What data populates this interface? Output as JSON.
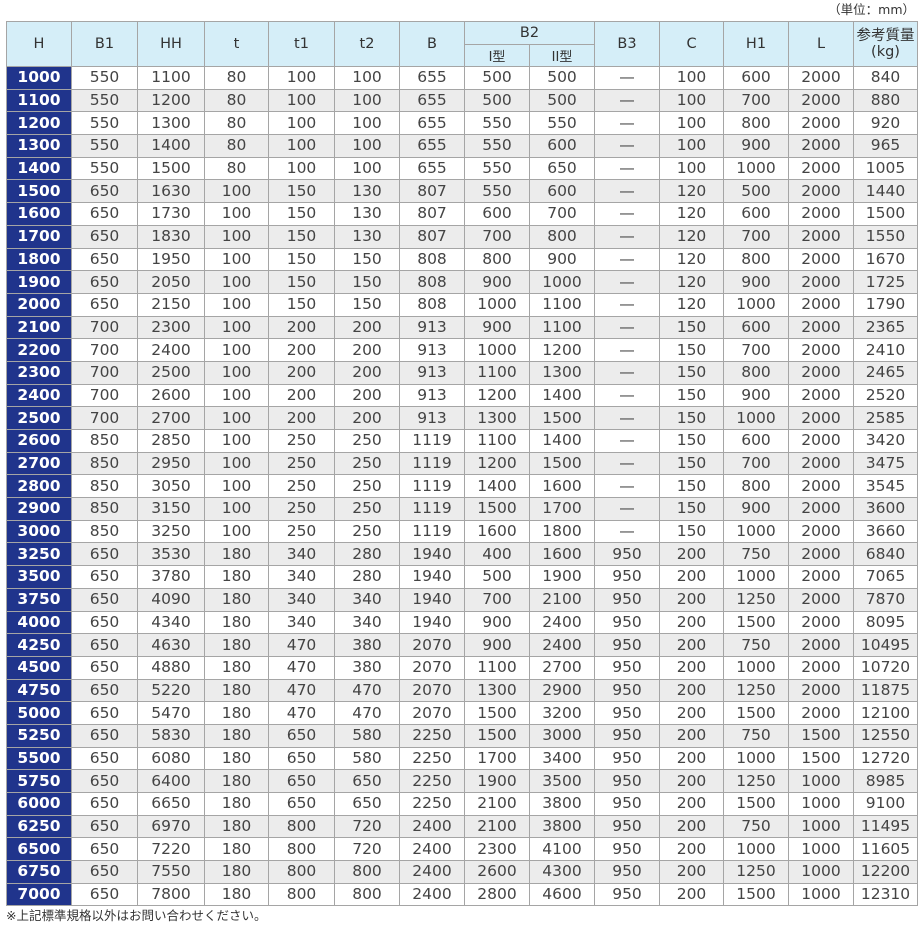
{
  "unit_label": "（単位：mm）",
  "headers": {
    "H": "H",
    "B1": "B1",
    "HH": "HH",
    "t": "t",
    "t1": "t1",
    "t2": "t2",
    "B": "B",
    "B2": "B2",
    "B2_type1": "I型",
    "B2_type2": "II型",
    "B3": "B3",
    "C": "C",
    "H1": "H1",
    "L": "L",
    "weight_line1": "参考質量",
    "weight_line2": "(kg)"
  },
  "rows": [
    [
      "1000",
      "550",
      "1100",
      "80",
      "100",
      "100",
      "655",
      "500",
      "500",
      "—",
      "100",
      "600",
      "2000",
      "840"
    ],
    [
      "1100",
      "550",
      "1200",
      "80",
      "100",
      "100",
      "655",
      "500",
      "500",
      "—",
      "100",
      "700",
      "2000",
      "880"
    ],
    [
      "1200",
      "550",
      "1300",
      "80",
      "100",
      "100",
      "655",
      "550",
      "550",
      "—",
      "100",
      "800",
      "2000",
      "920"
    ],
    [
      "1300",
      "550",
      "1400",
      "80",
      "100",
      "100",
      "655",
      "550",
      "600",
      "—",
      "100",
      "900",
      "2000",
      "965"
    ],
    [
      "1400",
      "550",
      "1500",
      "80",
      "100",
      "100",
      "655",
      "550",
      "650",
      "—",
      "100",
      "1000",
      "2000",
      "1005"
    ],
    [
      "1500",
      "650",
      "1630",
      "100",
      "150",
      "130",
      "807",
      "550",
      "600",
      "—",
      "120",
      "500",
      "2000",
      "1440"
    ],
    [
      "1600",
      "650",
      "1730",
      "100",
      "150",
      "130",
      "807",
      "600",
      "700",
      "—",
      "120",
      "600",
      "2000",
      "1500"
    ],
    [
      "1700",
      "650",
      "1830",
      "100",
      "150",
      "130",
      "807",
      "700",
      "800",
      "—",
      "120",
      "700",
      "2000",
      "1550"
    ],
    [
      "1800",
      "650",
      "1950",
      "100",
      "150",
      "150",
      "808",
      "800",
      "900",
      "—",
      "120",
      "800",
      "2000",
      "1670"
    ],
    [
      "1900",
      "650",
      "2050",
      "100",
      "150",
      "150",
      "808",
      "900",
      "1000",
      "—",
      "120",
      "900",
      "2000",
      "1725"
    ],
    [
      "2000",
      "650",
      "2150",
      "100",
      "150",
      "150",
      "808",
      "1000",
      "1100",
      "—",
      "120",
      "1000",
      "2000",
      "1790"
    ],
    [
      "2100",
      "700",
      "2300",
      "100",
      "200",
      "200",
      "913",
      "900",
      "1100",
      "—",
      "150",
      "600",
      "2000",
      "2365"
    ],
    [
      "2200",
      "700",
      "2400",
      "100",
      "200",
      "200",
      "913",
      "1000",
      "1200",
      "—",
      "150",
      "700",
      "2000",
      "2410"
    ],
    [
      "2300",
      "700",
      "2500",
      "100",
      "200",
      "200",
      "913",
      "1100",
      "1300",
      "—",
      "150",
      "800",
      "2000",
      "2465"
    ],
    [
      "2400",
      "700",
      "2600",
      "100",
      "200",
      "200",
      "913",
      "1200",
      "1400",
      "—",
      "150",
      "900",
      "2000",
      "2520"
    ],
    [
      "2500",
      "700",
      "2700",
      "100",
      "200",
      "200",
      "913",
      "1300",
      "1500",
      "—",
      "150",
      "1000",
      "2000",
      "2585"
    ],
    [
      "2600",
      "850",
      "2850",
      "100",
      "250",
      "250",
      "1119",
      "1100",
      "1400",
      "—",
      "150",
      "600",
      "2000",
      "3420"
    ],
    [
      "2700",
      "850",
      "2950",
      "100",
      "250",
      "250",
      "1119",
      "1200",
      "1500",
      "—",
      "150",
      "700",
      "2000",
      "3475"
    ],
    [
      "2800",
      "850",
      "3050",
      "100",
      "250",
      "250",
      "1119",
      "1400",
      "1600",
      "—",
      "150",
      "800",
      "2000",
      "3545"
    ],
    [
      "2900",
      "850",
      "3150",
      "100",
      "250",
      "250",
      "1119",
      "1500",
      "1700",
      "—",
      "150",
      "900",
      "2000",
      "3600"
    ],
    [
      "3000",
      "850",
      "3250",
      "100",
      "250",
      "250",
      "1119",
      "1600",
      "1800",
      "—",
      "150",
      "1000",
      "2000",
      "3660"
    ],
    [
      "3250",
      "650",
      "3530",
      "180",
      "340",
      "280",
      "1940",
      "400",
      "1600",
      "950",
      "200",
      "750",
      "2000",
      "6840"
    ],
    [
      "3500",
      "650",
      "3780",
      "180",
      "340",
      "280",
      "1940",
      "500",
      "1900",
      "950",
      "200",
      "1000",
      "2000",
      "7065"
    ],
    [
      "3750",
      "650",
      "4090",
      "180",
      "340",
      "340",
      "1940",
      "700",
      "2100",
      "950",
      "200",
      "1250",
      "2000",
      "7870"
    ],
    [
      "4000",
      "650",
      "4340",
      "180",
      "340",
      "340",
      "1940",
      "900",
      "2400",
      "950",
      "200",
      "1500",
      "2000",
      "8095"
    ],
    [
      "4250",
      "650",
      "4630",
      "180",
      "470",
      "380",
      "2070",
      "900",
      "2400",
      "950",
      "200",
      "750",
      "2000",
      "10495"
    ],
    [
      "4500",
      "650",
      "4880",
      "180",
      "470",
      "380",
      "2070",
      "1100",
      "2700",
      "950",
      "200",
      "1000",
      "2000",
      "10720"
    ],
    [
      "4750",
      "650",
      "5220",
      "180",
      "470",
      "470",
      "2070",
      "1300",
      "2900",
      "950",
      "200",
      "1250",
      "2000",
      "11875"
    ],
    [
      "5000",
      "650",
      "5470",
      "180",
      "470",
      "470",
      "2070",
      "1500",
      "3200",
      "950",
      "200",
      "1500",
      "2000",
      "12100"
    ],
    [
      "5250",
      "650",
      "5830",
      "180",
      "650",
      "580",
      "2250",
      "1500",
      "3000",
      "950",
      "200",
      "750",
      "1500",
      "12550"
    ],
    [
      "5500",
      "650",
      "6080",
      "180",
      "650",
      "580",
      "2250",
      "1700",
      "3400",
      "950",
      "200",
      "1000",
      "1500",
      "12720"
    ],
    [
      "5750",
      "650",
      "6400",
      "180",
      "650",
      "650",
      "2250",
      "1900",
      "3500",
      "950",
      "200",
      "1250",
      "1000",
      "8985"
    ],
    [
      "6000",
      "650",
      "6650",
      "180",
      "650",
      "650",
      "2250",
      "2100",
      "3800",
      "950",
      "200",
      "1500",
      "1000",
      "9100"
    ],
    [
      "6250",
      "650",
      "6970",
      "180",
      "800",
      "720",
      "2400",
      "2100",
      "3800",
      "950",
      "200",
      "750",
      "1000",
      "11495"
    ],
    [
      "6500",
      "650",
      "7220",
      "180",
      "800",
      "720",
      "2400",
      "2300",
      "4100",
      "950",
      "200",
      "1000",
      "1000",
      "11605"
    ],
    [
      "6750",
      "650",
      "7550",
      "180",
      "800",
      "800",
      "2400",
      "2600",
      "4300",
      "950",
      "200",
      "1250",
      "1000",
      "12200"
    ],
    [
      "7000",
      "650",
      "7800",
      "180",
      "800",
      "800",
      "2400",
      "2800",
      "4600",
      "950",
      "200",
      "1500",
      "1000",
      "12310"
    ]
  ],
  "note": "※上記標準規格以外はお問い合わせください。",
  "colors": {
    "header_bg": "#d5eef8",
    "h_column_bg": "#20348c",
    "stripe_bg": "#ececec"
  }
}
